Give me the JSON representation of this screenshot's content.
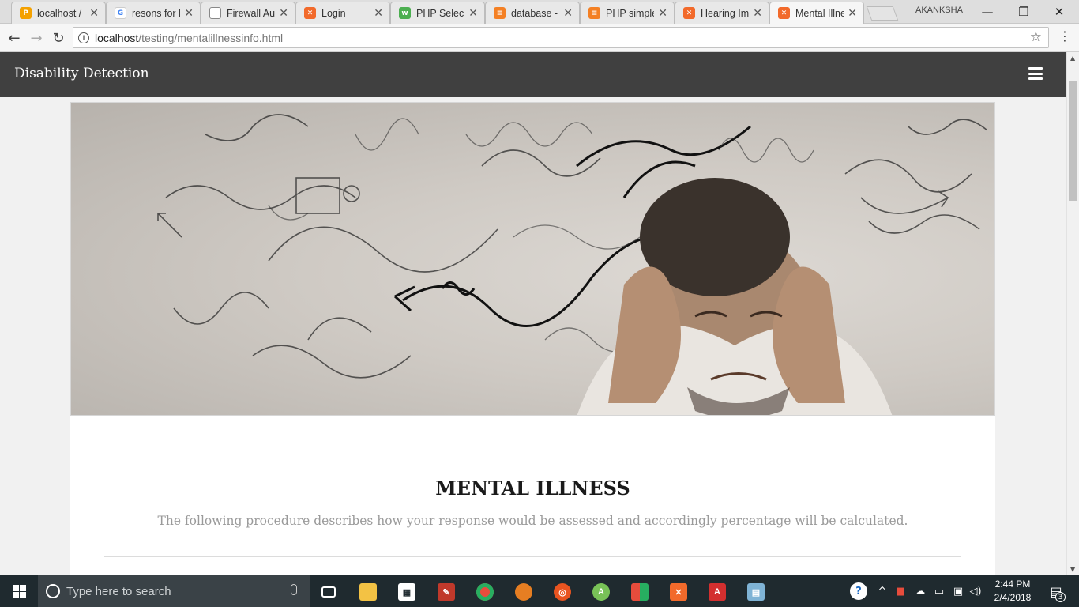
{
  "browser": {
    "tabs": [
      {
        "title": "localhost / l",
        "favicon": "phpmyadmin-icon"
      },
      {
        "title": "resons for l",
        "favicon": "google-icon"
      },
      {
        "title": "Firewall Au",
        "favicon": "page-icon"
      },
      {
        "title": "Login",
        "favicon": "xampp-icon"
      },
      {
        "title": "PHP Select",
        "favicon": "w3schools-icon"
      },
      {
        "title": "database -",
        "favicon": "stackoverflow-icon"
      },
      {
        "title": "PHP simple",
        "favicon": "stackoverflow-icon"
      },
      {
        "title": "Hearing Im",
        "favicon": "xampp-icon"
      },
      {
        "title": "Mental Illne",
        "favicon": "xampp-icon",
        "active": true
      }
    ],
    "profile_name": "AKANKSHA",
    "address": {
      "host": "localhost",
      "path": "/testing/mentalillnessinfo.html"
    }
  },
  "page": {
    "brand": "Disability Detection",
    "hero_alt": "Man holding head with chaotic scribbles",
    "heading": "MENTAL ILLNESS",
    "subheading": "The following procedure describes how your response would be assessed and accordingly percentage will be calculated."
  },
  "taskbar": {
    "search_placeholder": "Type here to search",
    "time": "2:44 PM",
    "date": "2/4/2018",
    "notification_count": "3",
    "pinned": [
      "task-view-icon",
      "file-explorer-icon",
      "store-icon",
      "app-icon",
      "chrome-icon",
      "firefox-icon",
      "ubuntu-icon",
      "android-studio-icon",
      "office-icon",
      "xampp-icon",
      "acrobat-icon",
      "notepad-icon"
    ]
  },
  "colors": {
    "navbar": "#404040",
    "taskbar": "#1f2a2f",
    "subheading": "#9a9a9a",
    "xampp": "#f26a2b"
  }
}
